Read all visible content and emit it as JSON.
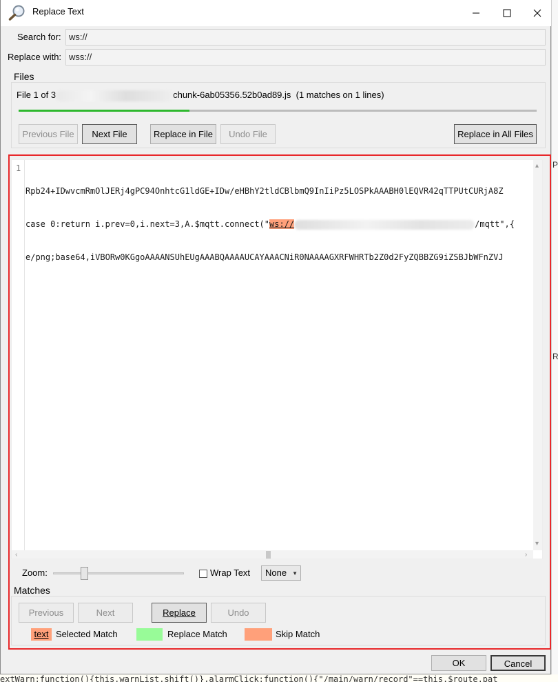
{
  "window": {
    "title": "Replace Text"
  },
  "search": {
    "label": "Search for:",
    "value": "ws://"
  },
  "replace": {
    "label": "Replace with:",
    "value": "wss://"
  },
  "files": {
    "section_title": "Files",
    "status_prefix": "File 1 of 3",
    "file_name": "chunk-6ab05356.52b0ad89.js",
    "match_summary": "(1 matches on 1 lines)",
    "progress": 0.33,
    "buttons": {
      "previous_file": "Previous File",
      "next_file": "Next File",
      "replace_in_file": "Replace in File",
      "undo_file": "Undo File",
      "replace_all_files": "Replace in All Files"
    }
  },
  "editor": {
    "line_number": "1",
    "lines": {
      "l1": "Rpb24+IDwvcmRmOlJERj4gPC94OnhtcG1ldGE+IDw/eHBhY2tldCBlbmQ9InIiPz5LOSPkAAABH0lEQVR42qTTPUtCURjA8Z",
      "l2_before": "case 0:return i.prev=0,i.next=3,A.$mqtt.connect(\"",
      "l2_match": "ws://",
      "l2_after": "/mqtt\",{",
      "l3": "e/png;base64,iVBORw0KGgoAAAANSUhEUgAAABQAAAAUCAYAAACNiR0NAAAAGXRFWHRTb2Z0d2FyZQBBZG9iZSBJbWFnZVJ"
    }
  },
  "view": {
    "zoom_label": "Zoom:",
    "wrap_text_label": "Wrap Text",
    "wrap_text_checked": false,
    "highlight_select": "None"
  },
  "matches": {
    "section_title": "Matches",
    "buttons": {
      "previous": "Previous",
      "next": "Next",
      "replace": "Replace",
      "undo": "Undo"
    },
    "legend": {
      "selected_swatch_text": "text",
      "selected_label": "Selected Match",
      "replace_label": "Replace Match",
      "skip_label": "Skip Match"
    }
  },
  "dialog_buttons": {
    "ok": "OK",
    "cancel": "Cancel"
  },
  "colors": {
    "highlight_red_frame": "#e8282a",
    "selected_match": "#ffa07a",
    "replace_match": "#98fb98",
    "skip_match": "#ffa07a",
    "progress_fill": "#2eb82e"
  },
  "background_app": {
    "right_fragments": [
      "Pa",
      "Re"
    ],
    "bottom_code": "extWarn:function(){this.warnList.shift()},alarmClick:function(){\"/main/warn/record\"==this.$route.pat"
  }
}
